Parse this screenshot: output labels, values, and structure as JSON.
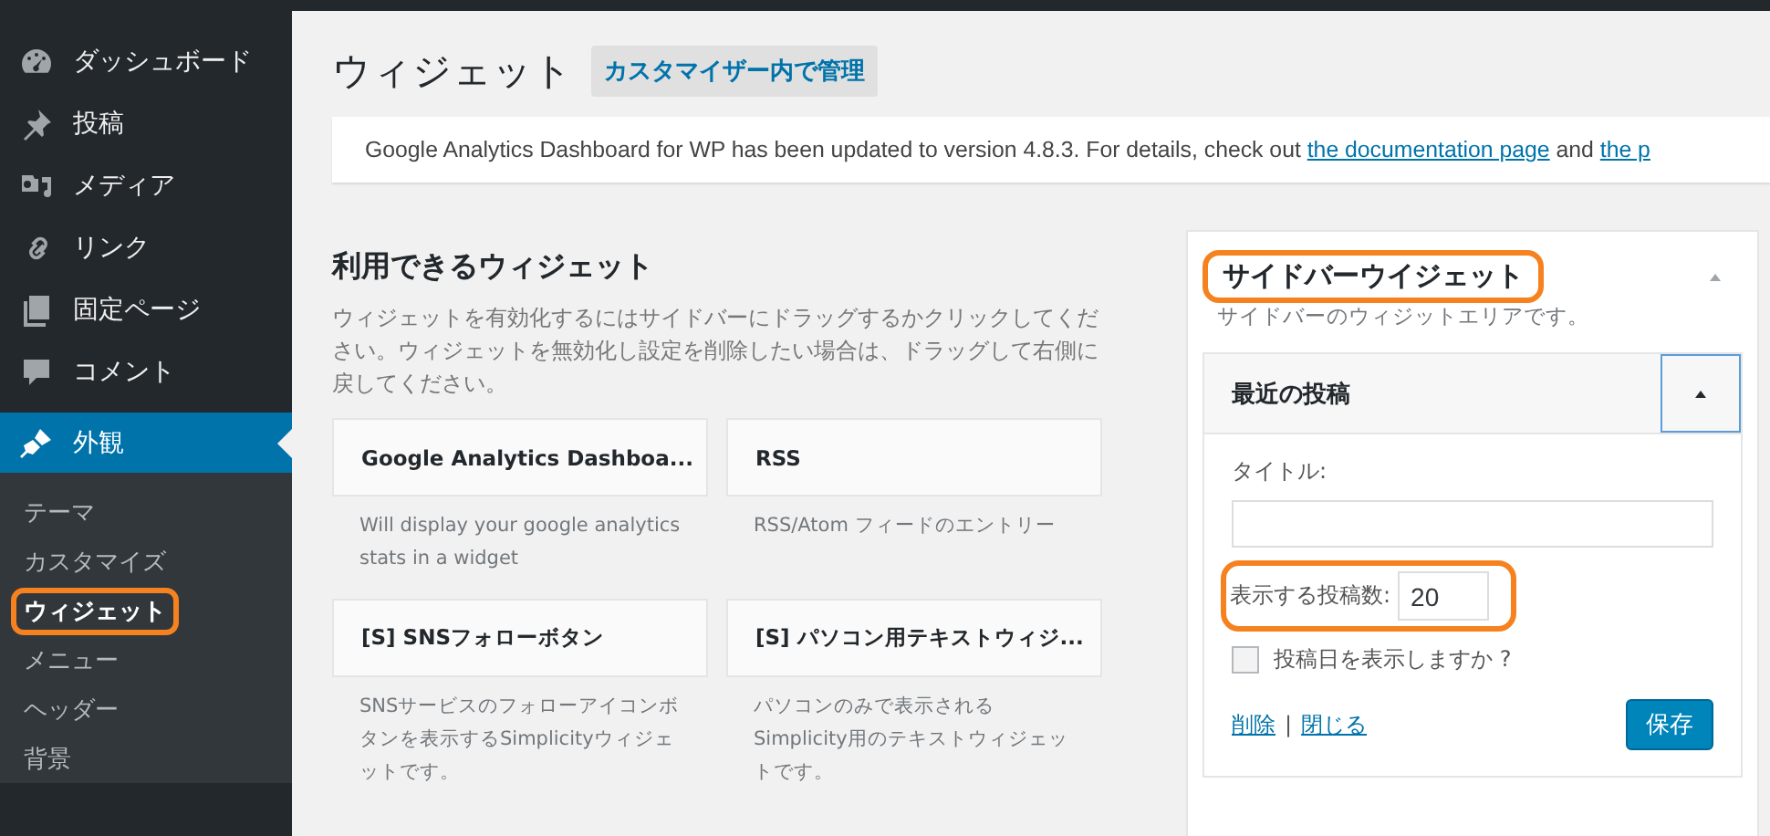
{
  "admin_menu": {
    "items": [
      {
        "label": "ダッシュボード",
        "selected": false
      },
      {
        "label": "投稿",
        "selected": false
      },
      {
        "label": "メディア",
        "selected": false
      },
      {
        "label": "リンク",
        "selected": false
      },
      {
        "label": "固定ページ",
        "selected": false
      },
      {
        "label": "コメント",
        "selected": false
      },
      {
        "label": "外観",
        "selected": true
      }
    ],
    "submenu": [
      {
        "label": "テーマ",
        "selected": false,
        "highlighted": false
      },
      {
        "label": "カスタマイズ",
        "selected": false,
        "highlighted": false
      },
      {
        "label": "ウィジェット",
        "selected": true,
        "highlighted": true
      },
      {
        "label": "メニュー",
        "selected": false,
        "highlighted": false
      },
      {
        "label": "ヘッダー",
        "selected": false,
        "highlighted": false
      },
      {
        "label": "背景",
        "selected": false,
        "highlighted": false
      }
    ]
  },
  "page": {
    "title": "ウィジェット",
    "action_button": "カスタマイザー内で管理"
  },
  "notice": {
    "parts": [
      {
        "kind": "text",
        "text": "Google Analytics Dashboard for WP has been updated to version 4.8.3. For details, check out "
      },
      {
        "kind": "link",
        "text": "the documentation page"
      },
      {
        "kind": "text",
        "text": " and "
      },
      {
        "kind": "link",
        "text": "the p"
      }
    ]
  },
  "available_widgets": {
    "title": "利用できるウィジェット",
    "description": "ウィジェットを有効化するにはサイドバーにドラッグするかクリックしてください。ウィジェットを無効化し設定を削除したい場合は、ドラッグして右側に戻してください。",
    "widgets": [
      {
        "title": "Google Analytics Dashboa...",
        "description": "Will display your google analytics stats in a widget"
      },
      {
        "title": "RSS",
        "description": "RSS/Atom フィードのエントリー"
      },
      {
        "title": "[S] SNSフォローボタン",
        "description": "SNSサービスのフォローアイコンボタンを表示するSimplicityウィジェットです。"
      },
      {
        "title": "[S] パソコン用テキストウィジ...",
        "description": "パソコンのみで表示されるSimplicity用のテキストウィジェットです。"
      }
    ]
  },
  "sidebar_area": {
    "title": "サイドバーウイジェット",
    "highlighted": true,
    "expanded": true,
    "description": "サイドバーのウィジットエリアです。",
    "widget": {
      "title": "最近の投稿",
      "expanded": true,
      "fields": [
        {
          "kind": "text",
          "label": "タイトル:"
        },
        {
          "kind": "number",
          "label": "表示する投稿数:",
          "value": "20",
          "highlighted": true
        },
        {
          "kind": "checkbox",
          "label": "投稿日を表示しますか ?",
          "checked": false
        }
      ],
      "links": [
        "削除",
        "閉じる"
      ],
      "separator": "|",
      "save_button": "保存"
    }
  }
}
